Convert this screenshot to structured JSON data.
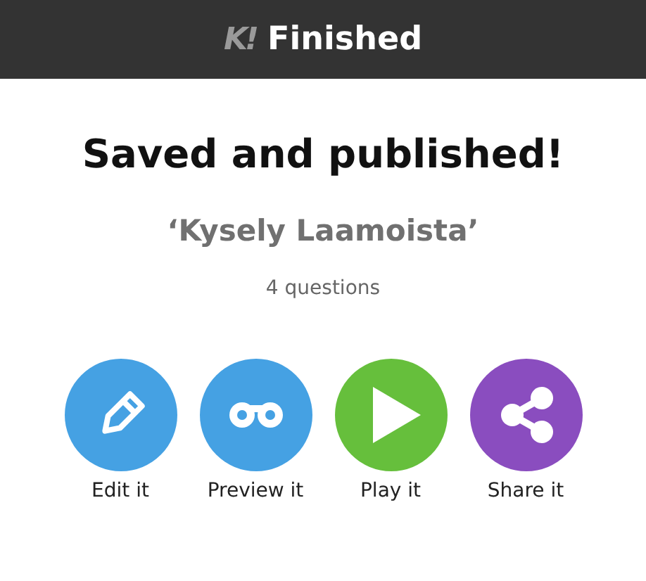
{
  "header": {
    "logo": "K!",
    "title": "Finished"
  },
  "heading": "Saved and published!",
  "quiz_title": "‘Kysely Laamoista’",
  "question_count": "4 questions",
  "actions": [
    {
      "kind": "edit",
      "label": "Edit it",
      "color": "#45a1e3"
    },
    {
      "kind": "preview",
      "label": "Preview it",
      "color": "#45a1e3"
    },
    {
      "kind": "play",
      "label": "Play it",
      "color": "#66bf3c"
    },
    {
      "kind": "share",
      "label": "Share it",
      "color": "#8a4dbf"
    }
  ]
}
